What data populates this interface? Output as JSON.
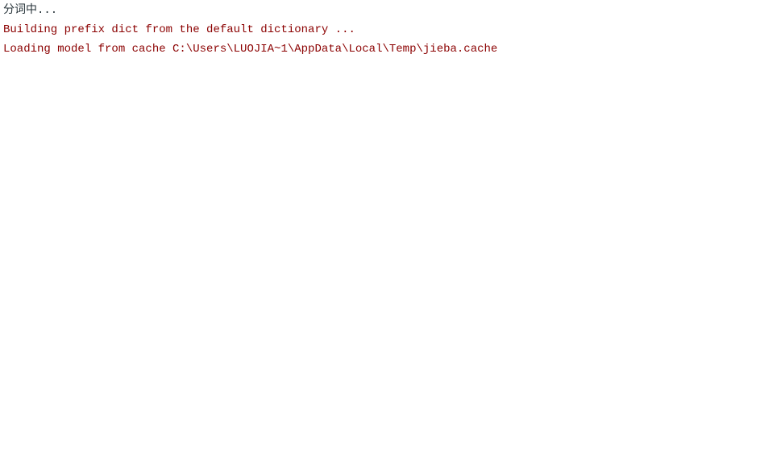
{
  "console": {
    "lines": [
      {
        "type": "stdout",
        "text": "分词中..."
      },
      {
        "type": "stderr",
        "text": "Building prefix dict from the default dictionary ..."
      },
      {
        "type": "stderr",
        "text": "Loading model from cache C:\\Users\\LUOJIA~1\\AppData\\Local\\Temp\\jieba.cache"
      }
    ]
  }
}
